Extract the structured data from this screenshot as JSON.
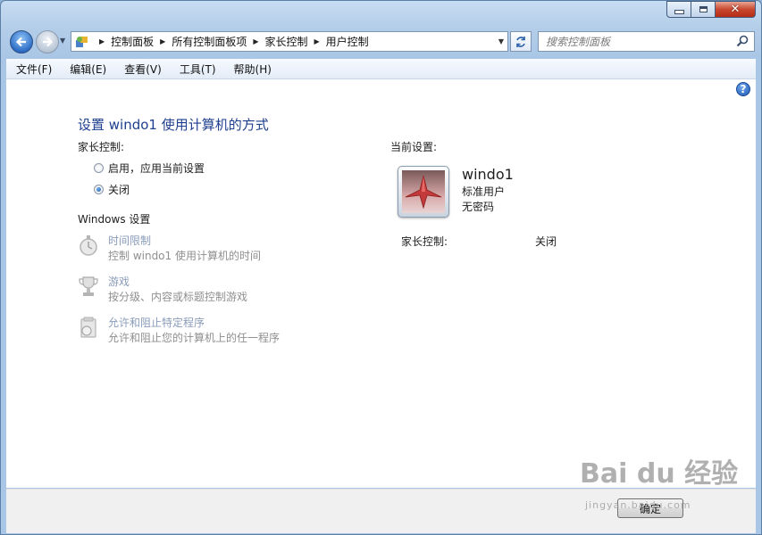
{
  "window": {
    "minimize_label": "–",
    "maximize_label": "□",
    "close_label": "✕"
  },
  "nav": {
    "back_icon": "back-arrow-icon",
    "forward_icon": "forward-arrow-icon"
  },
  "address": {
    "breadcrumbs": [
      "控制面板",
      "所有控制面板项",
      "家长控制",
      "用户控制"
    ]
  },
  "search": {
    "placeholder": "搜索控制面板"
  },
  "menu": {
    "items": [
      "文件(F)",
      "编辑(E)",
      "查看(V)",
      "工具(T)",
      "帮助(H)"
    ]
  },
  "page": {
    "title": "设置 windo1 使用计算机的方式",
    "parental_control_label": "家长控制:",
    "radio_on": "启用，应用当前设置",
    "radio_off": "关闭",
    "selected_option": "关闭",
    "windows_settings_label": "Windows 设置",
    "settings": [
      {
        "title": "时间限制",
        "desc": "控制 windo1 使用计算机的时间",
        "icon": "stopwatch-icon"
      },
      {
        "title": "游戏",
        "desc": "按分级、内容或标题控制游戏",
        "icon": "trophy-icon"
      },
      {
        "title": "允许和阻止特定程序",
        "desc": "允许和阻止您的计算机上的任一程序",
        "icon": "programs-icon"
      }
    ],
    "current_settings_label": "当前设置:",
    "user": {
      "name": "windo1",
      "type": "标准用户",
      "password": "无密码",
      "parental_control_label": "家长控制:",
      "parental_control_value": "关闭"
    }
  },
  "footer": {
    "ok_label": "确定"
  },
  "watermark": {
    "main": "Bai du 经验",
    "sub": "jingyan.baidu.com"
  },
  "colors": {
    "title_blue": "#1e3f8f",
    "disabled_link": "#8a9cba",
    "frame": "#b3cde8"
  }
}
